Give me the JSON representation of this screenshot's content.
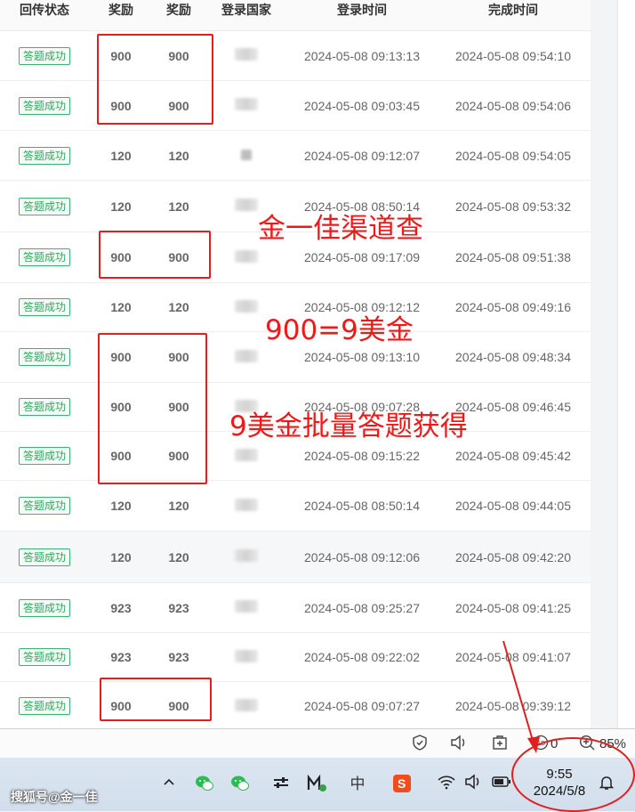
{
  "table": {
    "headers": {
      "status": "回传状态",
      "reward1": "奖励",
      "reward2": "奖励",
      "country": "登录国家",
      "login_time": "登录时间",
      "finish_time": "完成时间"
    },
    "rows": [
      {
        "status": "答题成功",
        "reward1": "900",
        "reward2": "900",
        "login": "2024-05-08 09:13:13",
        "finish": "2024-05-08 09:54:10"
      },
      {
        "status": "答题成功",
        "reward1": "900",
        "reward2": "900",
        "login": "2024-05-08 09:03:45",
        "finish": "2024-05-08 09:54:06"
      },
      {
        "status": "答题成功",
        "reward1": "120",
        "reward2": "120",
        "login": "2024-05-08 09:12:07",
        "finish": "2024-05-08 09:54:05"
      },
      {
        "status": "答题成功",
        "reward1": "120",
        "reward2": "120",
        "login": "2024-05-08 08:50:14",
        "finish": "2024-05-08 09:53:32"
      },
      {
        "status": "答题成功",
        "reward1": "900",
        "reward2": "900",
        "login": "2024-05-08 09:17:09",
        "finish": "2024-05-08 09:51:38"
      },
      {
        "status": "答题成功",
        "reward1": "120",
        "reward2": "120",
        "login": "2024-05-08 09:12:12",
        "finish": "2024-05-08 09:49:16"
      },
      {
        "status": "答题成功",
        "reward1": "900",
        "reward2": "900",
        "login": "2024-05-08 09:13:10",
        "finish": "2024-05-08 09:48:34"
      },
      {
        "status": "答题成功",
        "reward1": "900",
        "reward2": "900",
        "login": "2024-05-08 09:07:28",
        "finish": "2024-05-08 09:46:45"
      },
      {
        "status": "答题成功",
        "reward1": "900",
        "reward2": "900",
        "login": "2024-05-08 09:15:22",
        "finish": "2024-05-08 09:45:42"
      },
      {
        "status": "答题成功",
        "reward1": "120",
        "reward2": "120",
        "login": "2024-05-08 08:50:14",
        "finish": "2024-05-08 09:44:05"
      },
      {
        "status": "答题成功",
        "reward1": "120",
        "reward2": "120",
        "login": "2024-05-08 09:12:06",
        "finish": "2024-05-08 09:42:20"
      },
      {
        "status": "答题成功",
        "reward1": "923",
        "reward2": "923",
        "login": "2024-05-08 09:25:27",
        "finish": "2024-05-08 09:41:25"
      },
      {
        "status": "答题成功",
        "reward1": "923",
        "reward2": "923",
        "login": "2024-05-08 09:22:02",
        "finish": "2024-05-08 09:41:07"
      },
      {
        "status": "答题成功",
        "reward1": "900",
        "reward2": "900",
        "login": "2024-05-08 09:07:27",
        "finish": "2024-05-08 09:39:12"
      }
    ]
  },
  "annotations": {
    "text1": "金一佳渠道查",
    "text2": "900=9美金",
    "text3": "9美金批量答题获得"
  },
  "status_bar": {
    "ad_count": "0",
    "zoom": "85%"
  },
  "taskbar": {
    "watermark": "搜狐号@金一佳",
    "ime_label": "中",
    "time": "9:55",
    "date": "2024/5/8"
  },
  "colors": {
    "reward_red": "#e0191f",
    "badge_green": "#2fa75c",
    "annotation_red": "#f01919"
  }
}
